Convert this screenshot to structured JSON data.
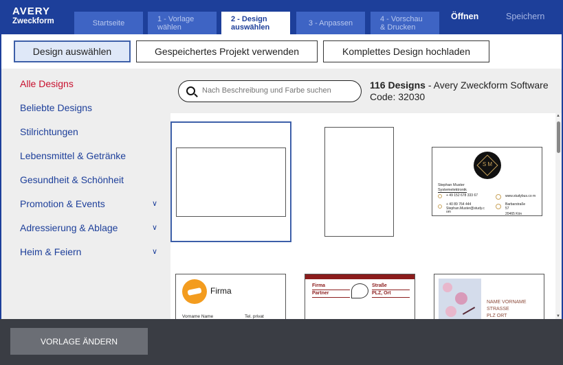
{
  "brand": {
    "line1": "AVERY",
    "line2": "Zweckform"
  },
  "steps": [
    {
      "label": "Startseite"
    },
    {
      "label": "1 - Vorlage wählen"
    },
    {
      "label": "2 - Design auswählen"
    },
    {
      "label": "3 - Anpassen"
    },
    {
      "label": "4 - Vorschau & Drucken"
    }
  ],
  "header_links": {
    "open": "Öffnen",
    "save": "Speichern"
  },
  "actions": {
    "select_design": "Design auswählen",
    "use_saved": "Gespeichertes Projekt verwenden",
    "upload_design": "Komplettes Design hochladen"
  },
  "categories": [
    {
      "label": "Alle Designs",
      "active": true
    },
    {
      "label": "Beliebte Designs"
    },
    {
      "label": "Stilrichtungen"
    },
    {
      "label": "Lebensmittel & Getränke"
    },
    {
      "label": "Gesundheit & Schönheit"
    },
    {
      "label": "Promotion & Events",
      "expandable": true
    },
    {
      "label": "Adressierung & Ablage",
      "expandable": true
    },
    {
      "label": "Heim & Feiern",
      "expandable": true
    }
  ],
  "search": {
    "placeholder": "Nach Beschreibung und Farbe suchen"
  },
  "results": {
    "count": "116 Designs",
    "suffix": " - Avery Zweckform Software Code: 32030"
  },
  "cards": {
    "monogram": {
      "initials": "S M",
      "name": "Stephan Muster",
      "title": "Systemelektronik",
      "phone1": "+ 49 152 678 333 67",
      "phone2": "+ 40 89 764 444",
      "email": "Stephan.Muster@study.c om",
      "web": "www.studybus.co m",
      "street": "Barbarstraße 57",
      "city": "20465 Kön"
    },
    "firma": {
      "company": "Firma",
      "name": "Vorname Name",
      "tel": "Tel. privat"
    },
    "partner": {
      "left1": "Firma",
      "left2": "Partner",
      "right1": "Straße",
      "right2": "PLZ, Ort"
    },
    "orchid": {
      "l1": "NAME VORNAME",
      "l2": "STRASSE",
      "l3": "PLZ ORT"
    }
  },
  "bottom": {
    "change_template": "VORLAGE ÄNDERN"
  },
  "colors": {
    "brand_blue": "#1d3f9a",
    "active_red": "#c8102e",
    "footer": "#3a3d44"
  }
}
